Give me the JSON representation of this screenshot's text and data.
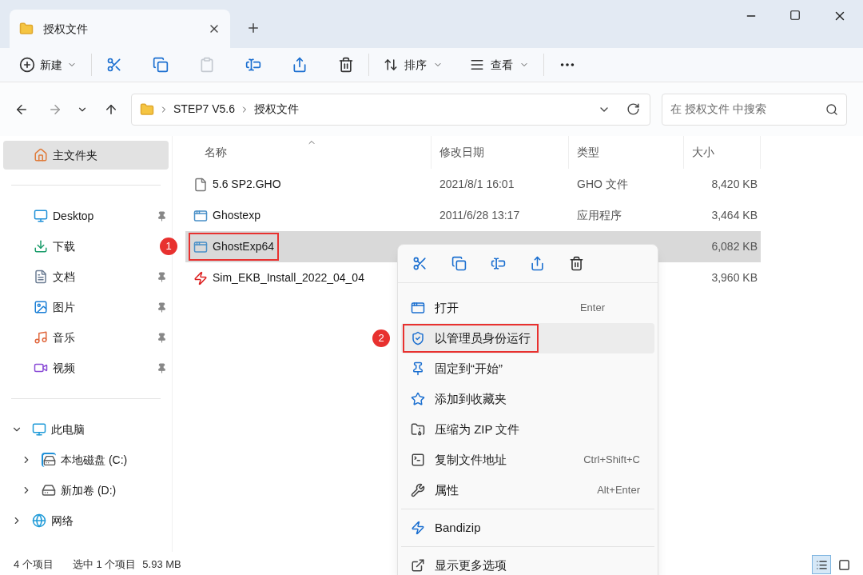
{
  "tabs": [
    {
      "title": "授权文件",
      "selected": true
    }
  ],
  "toolbar": {
    "new_label": "新建",
    "paste_disabled": true,
    "sort_label": "排序",
    "view_label": "查看"
  },
  "address": {
    "crumbs": [
      "STEP7 V5.6",
      "授权文件"
    ]
  },
  "search": {
    "placeholder": "在 授权文件 中搜索"
  },
  "sidebar": {
    "home": {
      "label": "主文件夹",
      "selected": true
    },
    "quick": [
      {
        "kind": "desktop",
        "label": "Desktop",
        "pinned": true
      },
      {
        "kind": "downloads",
        "label": "下载",
        "pinned": false
      },
      {
        "kind": "documents",
        "label": "文档",
        "pinned": true
      },
      {
        "kind": "pictures",
        "label": "图片",
        "pinned": true
      },
      {
        "kind": "music",
        "label": "音乐",
        "pinned": true
      },
      {
        "kind": "videos",
        "label": "视频",
        "pinned": true
      }
    ],
    "tree": [
      {
        "kind": "pc",
        "label": "此电脑",
        "expanded": true,
        "children": [
          {
            "kind": "system-drive",
            "label": "本地磁盘 (C:)",
            "expanded": false
          },
          {
            "kind": "drive",
            "label": "新加卷 (D:)",
            "expanded": false
          }
        ]
      },
      {
        "kind": "network",
        "label": "网络",
        "expanded": false
      }
    ]
  },
  "files": {
    "columns": [
      "名称",
      "修改日期",
      "类型",
      "大小"
    ],
    "rows": [
      {
        "kind": "file",
        "name": "5.6 SP2.GHO",
        "date": "2021/8/1 16:01",
        "type": "GHO 文件",
        "size": "8,420 KB",
        "selected": false
      },
      {
        "kind": "app",
        "name": "Ghostexp",
        "date": "2011/6/28 13:17",
        "type": "应用程序",
        "size": "3,464 KB",
        "selected": false
      },
      {
        "kind": "app",
        "name": "GhostExp64",
        "size": "6,082 KB",
        "selected": true,
        "callout": "1"
      },
      {
        "kind": "installer",
        "name": "Sim_EKB_Install_2022_04_04",
        "size": "3,960 KB",
        "selected": false
      }
    ]
  },
  "context_menu": {
    "items": [
      {
        "kind": "open",
        "label": "打开",
        "shortcut": "Enter",
        "highlighted": false
      },
      {
        "kind": "admin",
        "label": "以管理员身份运行",
        "highlighted": true,
        "callout": "2"
      },
      {
        "kind": "pin",
        "label": "固定到“开始”",
        "highlighted": false
      },
      {
        "kind": "favorite",
        "label": "添加到收藏夹",
        "highlighted": false
      },
      {
        "kind": "zip",
        "label": "压缩为 ZIP 文件",
        "highlighted": false
      },
      {
        "kind": "path",
        "label": "复制文件地址",
        "shortcut": "Ctrl+Shift+C",
        "highlighted": false
      },
      {
        "kind": "properties",
        "label": "属性",
        "shortcut": "Alt+Enter",
        "highlighted": false
      },
      {
        "kind": "separator"
      },
      {
        "kind": "bandizip",
        "label": "Bandizip",
        "highlighted": false
      },
      {
        "kind": "separator"
      },
      {
        "kind": "more",
        "label": "显示更多选项",
        "highlighted": false
      }
    ]
  },
  "status": {
    "count": "4 个项目",
    "selection": "选中 1 个项目",
    "size": "5.93 MB",
    "views": [
      {
        "kind": "details",
        "selected": true
      },
      {
        "kind": "tiles",
        "selected": false
      }
    ]
  }
}
